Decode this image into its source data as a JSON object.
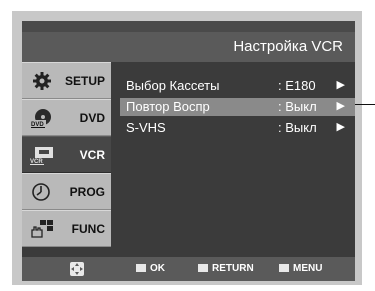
{
  "header": {
    "title": "Настройка VCR"
  },
  "sidebar": {
    "tabs": [
      {
        "label": "SETUP",
        "icon": "gear-icon",
        "active": false
      },
      {
        "label": "DVD",
        "icon": "dvd-disc-icon",
        "active": false
      },
      {
        "label": "VCR",
        "icon": "vcr-cassette-icon",
        "active": true
      },
      {
        "label": "PROG",
        "icon": "clock-icon",
        "active": false
      },
      {
        "label": "FUNC",
        "icon": "hand-grid-icon",
        "active": false
      }
    ]
  },
  "menu": {
    "items": [
      {
        "label": "Выбор Кассеты",
        "value": ": E180",
        "arrow": "▶",
        "selected": false
      },
      {
        "label": "Повтор Воспр",
        "value": ": Выкл",
        "arrow": "▶",
        "selected": true
      },
      {
        "label": "S-VHS",
        "value": ": Выкл",
        "arrow": "▶",
        "selected": false
      }
    ]
  },
  "footer": {
    "ok_label": "OK",
    "return_label": "RETURN",
    "menu_label": "MENU"
  },
  "colors": {
    "screen_bg": "#3b3b3b",
    "titlebar_bg": "#5a5a5a",
    "tab_bg": "#b9b9b9",
    "tab_active_bg": "#474747",
    "selected_row_bg": "#8a8a8a"
  }
}
